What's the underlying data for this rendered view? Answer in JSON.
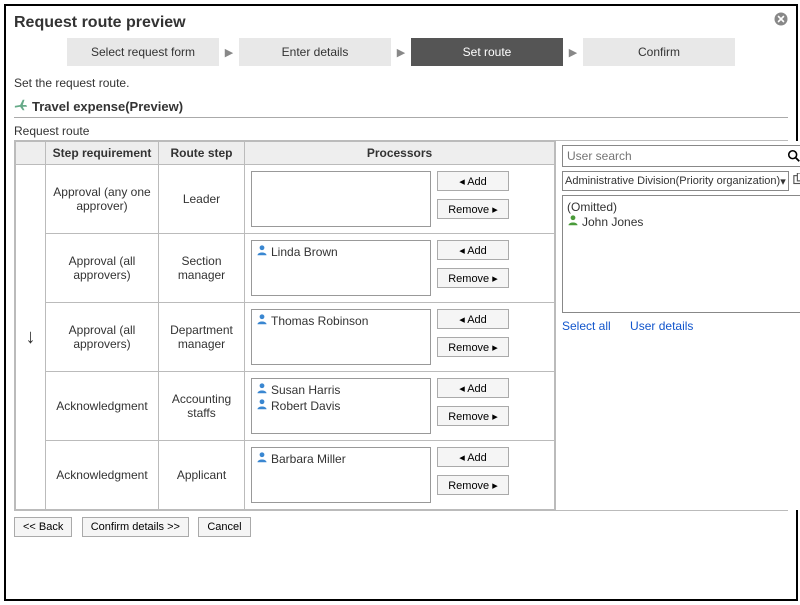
{
  "title": "Request route preview",
  "wizard": {
    "steps": [
      "Select request form",
      "Enter details",
      "Set route",
      "Confirm"
    ],
    "activeIndex": 2
  },
  "instruction": "Set the request route.",
  "previewTitle": "Travel expense(Preview)",
  "sectionLabel": "Request route",
  "tableHeaders": {
    "stepReq": "Step requirement",
    "routeStep": "Route step",
    "processors": "Processors"
  },
  "addLabel": "Add",
  "removeLabel": "Remove",
  "rows": [
    {
      "requirement": "Approval (any one approver)",
      "routeStep": "Leader",
      "processors": []
    },
    {
      "requirement": "Approval (all approvers)",
      "routeStep": "Section manager",
      "processors": [
        "Linda Brown"
      ]
    },
    {
      "requirement": "Approval (all approvers)",
      "routeStep": "Department manager",
      "processors": [
        "Thomas Robinson"
      ]
    },
    {
      "requirement": "Acknowledgment",
      "routeStep": "Accounting staffs",
      "processors": [
        "Susan Harris",
        "Robert Davis"
      ]
    },
    {
      "requirement": "Acknowledgment",
      "routeStep": "Applicant",
      "processors": [
        "Barbara Miller"
      ]
    }
  ],
  "side": {
    "searchPlaceholder": "User search",
    "orgSelected": "Administrative Division(Priority organization)",
    "omitted": "(Omitted)",
    "users": [
      "John Jones"
    ],
    "selectAll": "Select all",
    "userDetails": "User details"
  },
  "footer": {
    "back": "<<  Back",
    "confirm": "Confirm details  >>",
    "cancel": "Cancel"
  }
}
